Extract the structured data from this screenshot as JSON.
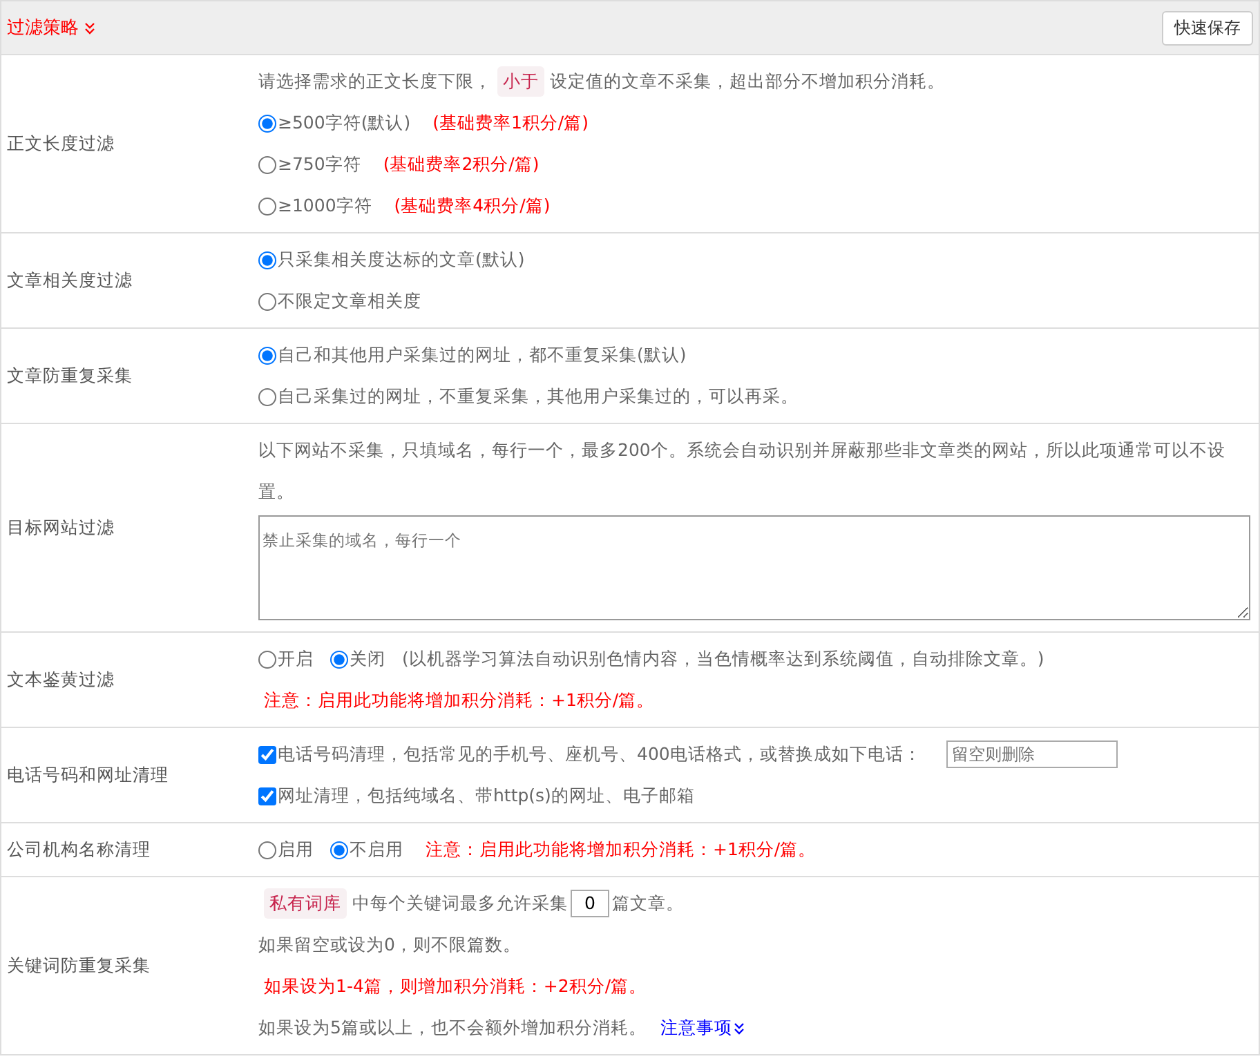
{
  "header": {
    "title": "过滤策略",
    "save_button": "快速保存"
  },
  "rows": [
    {
      "label": "正文长度过滤",
      "lines": [
        [
          {
            "kind": "text",
            "text": "请选择需求的正文长度下限，"
          },
          {
            "kind": "tag",
            "text": "小于"
          },
          {
            "kind": "text",
            "text": "设定值的文章不采集，超出部分不增加积分消耗。"
          }
        ],
        [
          {
            "kind": "radio",
            "text": "≥500字符(默认)",
            "selected": true
          },
          {
            "kind": "note",
            "text": "(基础费率1积分/篇)"
          }
        ],
        [
          {
            "kind": "radio",
            "text": "≥750字符",
            "selected": false
          },
          {
            "kind": "note",
            "text": "(基础费率2积分/篇)"
          }
        ],
        [
          {
            "kind": "radio",
            "text": "≥1000字符",
            "selected": false
          },
          {
            "kind": "note",
            "text": "(基础费率4积分/篇)"
          }
        ]
      ]
    },
    {
      "label": "文章相关度过滤",
      "lines": [
        [
          {
            "kind": "radio",
            "text": "只采集相关度达标的文章(默认)",
            "selected": true
          }
        ],
        [
          {
            "kind": "radio",
            "text": "不限定文章相关度",
            "selected": false
          }
        ]
      ]
    },
    {
      "label": "文章防重复采集",
      "lines": [
        [
          {
            "kind": "radio",
            "text": "自己和其他用户采集过的网址，都不重复采集(默认)",
            "selected": true
          }
        ],
        [
          {
            "kind": "radio",
            "text": "自己采集过的网址，不重复采集，其他用户采集过的，可以再采。",
            "selected": false
          }
        ]
      ]
    },
    {
      "label": "目标网站过滤",
      "lines": [
        [
          {
            "kind": "text",
            "text": "以下网站不采集，只填域名，每行一个，最多200个。系统会自动识别并屏蔽那些非文章类的网站，所以此项通常可以不设置。"
          }
        ],
        [
          {
            "kind": "textarea",
            "placeholder": "禁止采集的域名，每行一个"
          }
        ]
      ]
    },
    {
      "label": "文本鉴黄过滤",
      "lines": [
        [
          {
            "kind": "radio",
            "text": "开启",
            "selected": false
          },
          {
            "kind": "radio",
            "text": "关闭",
            "selected": true
          },
          {
            "kind": "text",
            "text": "(以机器学习算法自动识别色情内容，当色情概率达到系统阈值，自动排除文章。)"
          }
        ],
        [
          {
            "kind": "note",
            "text": "注意：启用此功能将增加积分消耗：+1积分/篇。"
          }
        ]
      ]
    },
    {
      "label": "电话号码和网址清理",
      "lines": [
        [
          {
            "kind": "checkbox",
            "text": "电话号码清理，包括常见的手机号、座机号、400电话格式，或替换成如下电话：",
            "checked": true
          },
          {
            "kind": "input",
            "placeholder": "留空则删除"
          }
        ],
        [
          {
            "kind": "checkbox",
            "text": "网址清理，包括纯域名、带http(s)的网址、电子邮箱",
            "checked": true
          }
        ]
      ]
    },
    {
      "label": "公司机构名称清理",
      "lines": [
        [
          {
            "kind": "radio",
            "text": "启用",
            "selected": false
          },
          {
            "kind": "radio",
            "text": "不启用",
            "selected": true
          },
          {
            "kind": "note",
            "text": "注意：启用此功能将增加积分消耗：+1积分/篇。"
          }
        ]
      ]
    },
    {
      "label": "关键词防重复采集",
      "lines": [
        [
          {
            "kind": "tag",
            "text": "私有词库"
          },
          {
            "kind": "text",
            "text": "中每个关键词最多允许采集"
          },
          {
            "kind": "number",
            "value": "0"
          },
          {
            "kind": "text",
            "text": "篇文章。"
          }
        ],
        [
          {
            "kind": "text",
            "text": "如果留空或设为0，则不限篇数。"
          }
        ],
        [
          {
            "kind": "note",
            "text": "如果设为1-4篇，则增加积分消耗：+2积分/篇。"
          }
        ],
        [
          {
            "kind": "text",
            "text": "如果设为5篇或以上，也不会额外增加积分消耗。"
          },
          {
            "kind": "link",
            "text": "注意事项"
          }
        ]
      ]
    }
  ]
}
